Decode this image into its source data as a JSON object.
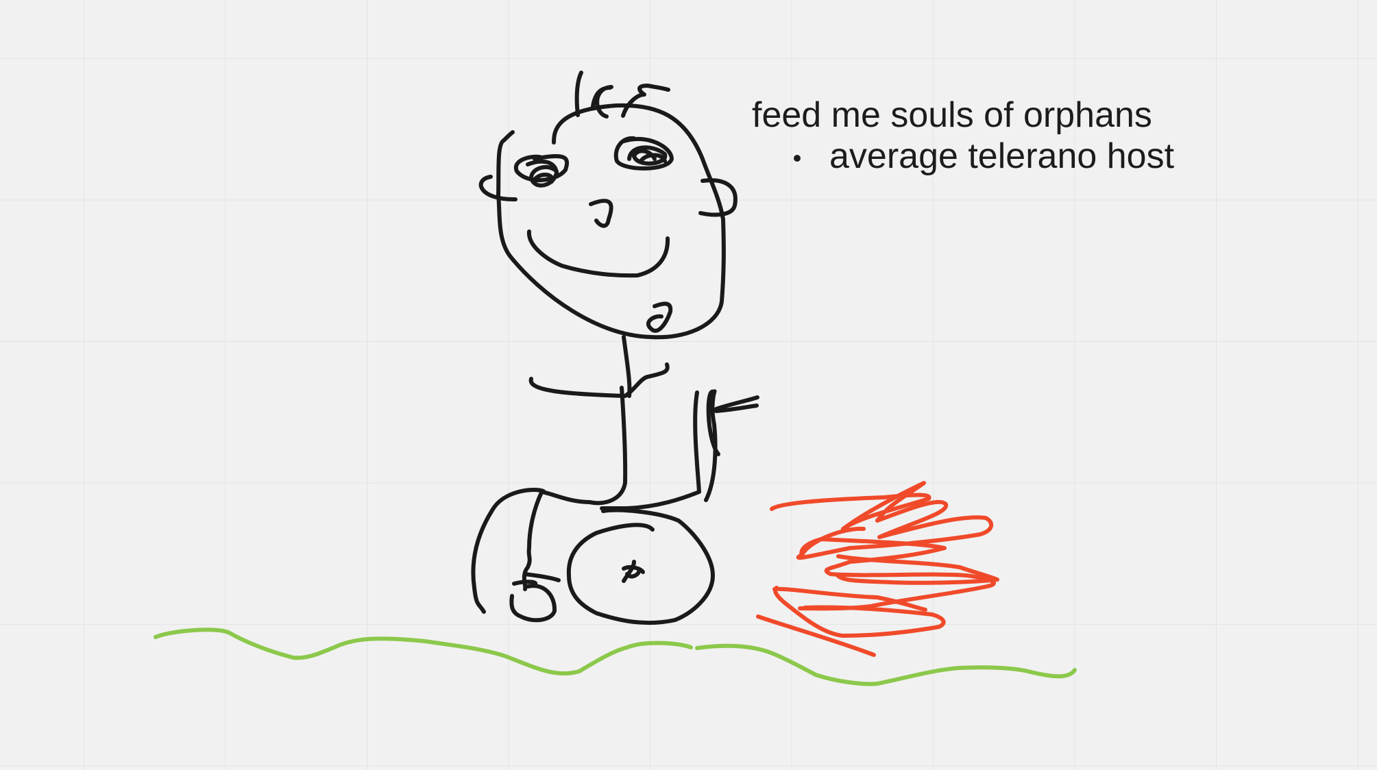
{
  "whiteboard": {
    "note": {
      "line1": "feed me souls of orphans",
      "bullet1": "average telerano host"
    },
    "colors": {
      "background": "#f1f1f1",
      "grid": "#e3e3e3",
      "ink_black": "#1a1a1a",
      "ink_red": "#f04a2a",
      "ink_green": "#8cc84b"
    }
  }
}
